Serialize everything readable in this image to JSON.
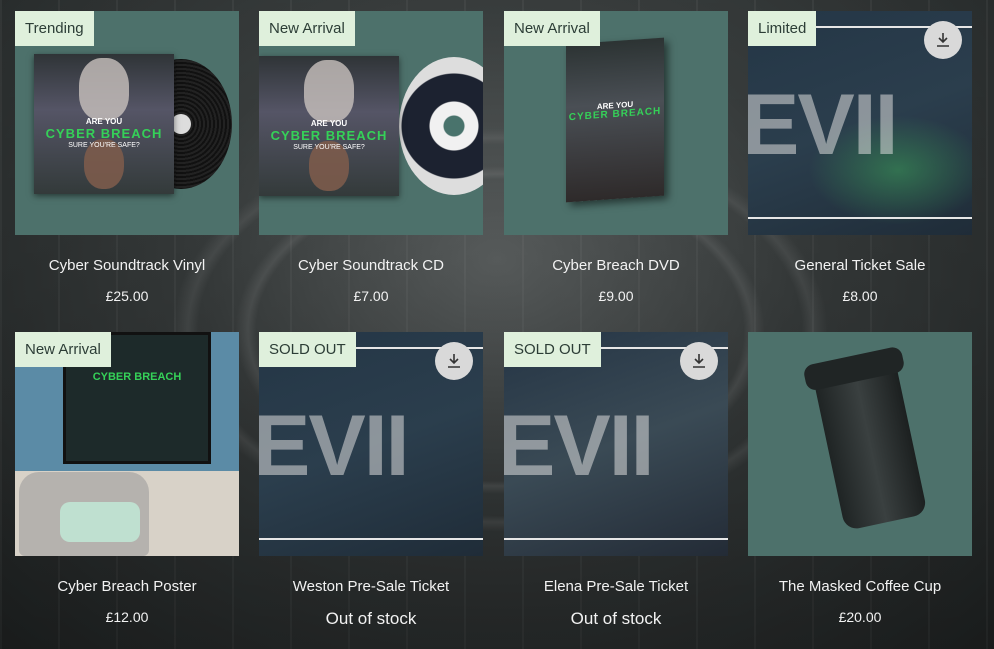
{
  "products": [
    {
      "ribbon": "Trending",
      "title": "Cyber Soundtrack Vinyl",
      "price": "£25.00",
      "stock": ""
    },
    {
      "ribbon": "New Arrival",
      "title": "Cyber Soundtrack CD",
      "price": "£7.00",
      "stock": ""
    },
    {
      "ribbon": "New Arrival",
      "title": "Cyber Breach DVD",
      "price": "£9.00",
      "stock": ""
    },
    {
      "ribbon": "Limited",
      "title": "General Ticket Sale",
      "price": "£8.00",
      "stock": ""
    },
    {
      "ribbon": "New Arrival",
      "title": "Cyber Breach Poster",
      "price": "£12.00",
      "stock": ""
    },
    {
      "ribbon": "SOLD OUT",
      "title": "Weston Pre-Sale Ticket",
      "price": "",
      "stock": "Out of stock"
    },
    {
      "ribbon": "SOLD OUT",
      "title": "Elena Pre-Sale Ticket",
      "price": "",
      "stock": "Out of stock"
    },
    {
      "ribbon": "",
      "title": "The Masked Coffee Cup",
      "price": "£20.00",
      "stock": ""
    }
  ],
  "art": {
    "cover_line1": "ARE YOU",
    "cover_line2": "CYBER BREACH",
    "cover_line3": "SURE YOU'RE SAFE?",
    "ticket_word": "EVII"
  },
  "icons": {
    "download": "download-icon"
  },
  "colors": {
    "ribbon_bg": "#dff0dc",
    "thumb_bg": "#4d716b",
    "text": "#f2f2f2"
  }
}
